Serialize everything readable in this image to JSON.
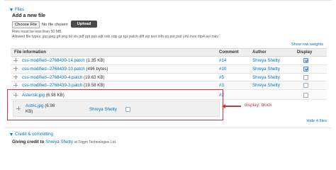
{
  "files_section": {
    "legend": "Files"
  },
  "add_file": {
    "title": "Add a new file",
    "choose_label": "Choose File",
    "no_file_text": "No file chosen",
    "upload_label": "Upload",
    "size_limit": "Files must be less than 50 MB.",
    "allowed_types": "Allowed file types: jpg jpeg gif png txt xls pdf ppt pps odt ods odp gz tgz patch diff zip test info po pot psd yml mov mp4 avi mkv."
  },
  "show_row_weights": "Show row weights",
  "table": {
    "headers": {
      "file": "File information",
      "comment": "Comment",
      "author": "Author",
      "display": "Display"
    },
    "rows": [
      {
        "name": "css-modified--2768439-14.patch",
        "size": "(1.35 KB)",
        "comment": "#14",
        "author": "Shreya Shetty",
        "display": true
      },
      {
        "name": "css-modified--2768439-10.patch",
        "size": "(496 bytes)",
        "comment": "#10",
        "author": "Shreya Shetty",
        "display": true
      },
      {
        "name": "css-modified--2768439-4.patch",
        "size": "(19.63 KB)",
        "comment": "#5",
        "author": "Shreya Shetty",
        "display": false
      },
      {
        "name": "css-modified--2768439-3.patch",
        "size": "(19.58 KB)",
        "comment": "#3",
        "author": "Shreya Shetty",
        "display": false
      }
    ],
    "asterisk_row": {
      "name": "Asterisk.jpg",
      "size": "(6.98 KB)",
      "comment": "#2"
    },
    "nested_row": {
      "name": "Astric.jpg",
      "size_line1": "(6.98",
      "size_line2": "KB)",
      "author": "Shreya Shetty"
    }
  },
  "callout": "display: block",
  "hide_link": "Hide 4 files",
  "credit": {
    "legend": "Credit & committing",
    "prefix": "Giving credit to",
    "name": "Shreya Shetty",
    "at_org": "at Trigyn Technologies Ltd"
  },
  "colors": {
    "link": "#0074bd",
    "annotation": "#c43a3a",
    "upload_bg": "#4a4a4a"
  },
  "icons": [
    "collapse-triangle-icon",
    "drag-handle-icon",
    "checkbox-icon",
    "arrow-left-icon"
  ]
}
